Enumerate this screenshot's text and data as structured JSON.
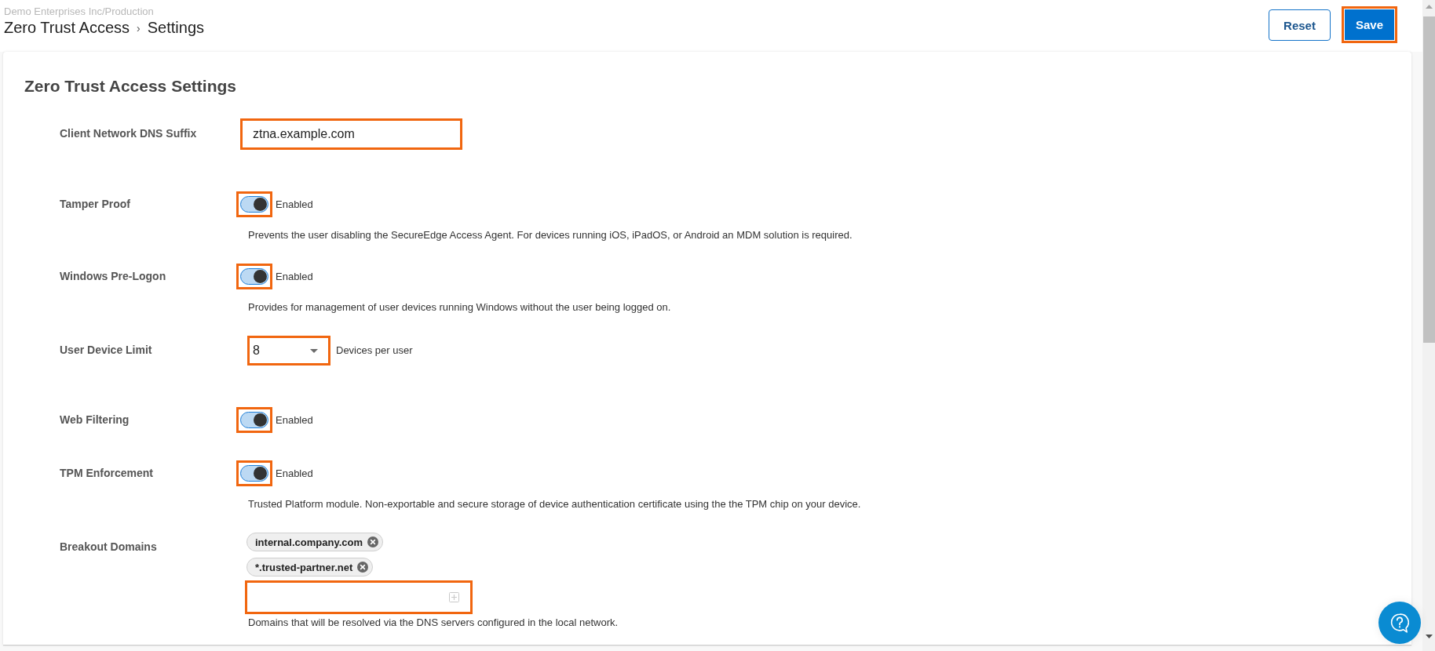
{
  "header": {
    "tenant": "Demo Enterprises Inc/Production",
    "path": [
      "Zero Trust Access",
      "Settings"
    ],
    "separator": "›"
  },
  "actions": [
    {
      "label": "Reset",
      "kind": "secondary",
      "highlighted": false
    },
    {
      "label": "Save",
      "kind": "primary",
      "highlighted": true
    }
  ],
  "settings": {
    "title": "Zero Trust Access Settings",
    "fields": [
      {
        "kind": "text",
        "label": "Client Network DNS Suffix",
        "value": "ztna.example.com",
        "highlighted": true
      },
      {
        "kind": "toggle",
        "label": "Tamper Proof",
        "on": true,
        "status": "Enabled",
        "description": "Prevents the user disabling the SecureEdge Access Agent. For devices running iOS, iPadOS, or Android an MDM solution is required.",
        "highlighted": true
      },
      {
        "kind": "toggle",
        "label": "Windows Pre-Logon",
        "on": true,
        "status": "Enabled",
        "description": "Provides for management of user devices running Windows without the user being logged on.",
        "highlighted": true
      },
      {
        "kind": "select",
        "label": "User Device Limit",
        "value": "8",
        "suffix": "Devices per user",
        "highlighted": true
      },
      {
        "kind": "toggle",
        "label": "Web Filtering",
        "on": true,
        "status": "Enabled",
        "highlighted": true
      },
      {
        "kind": "toggle",
        "label": "TPM Enforcement",
        "on": true,
        "status": "Enabled",
        "description": "Trusted Platform module. Non-exportable and secure storage of device authentication certificate using the the TPM chip on your device.",
        "highlighted": true
      },
      {
        "kind": "tags",
        "label": "Breakout Domains",
        "tags": [
          {
            "label": "internal.company.com"
          },
          {
            "label": "*.trusted-partner.net"
          }
        ],
        "description": "Domains that will be resolved via the DNS servers configured in the local network.",
        "highlighted": true
      }
    ]
  }
}
